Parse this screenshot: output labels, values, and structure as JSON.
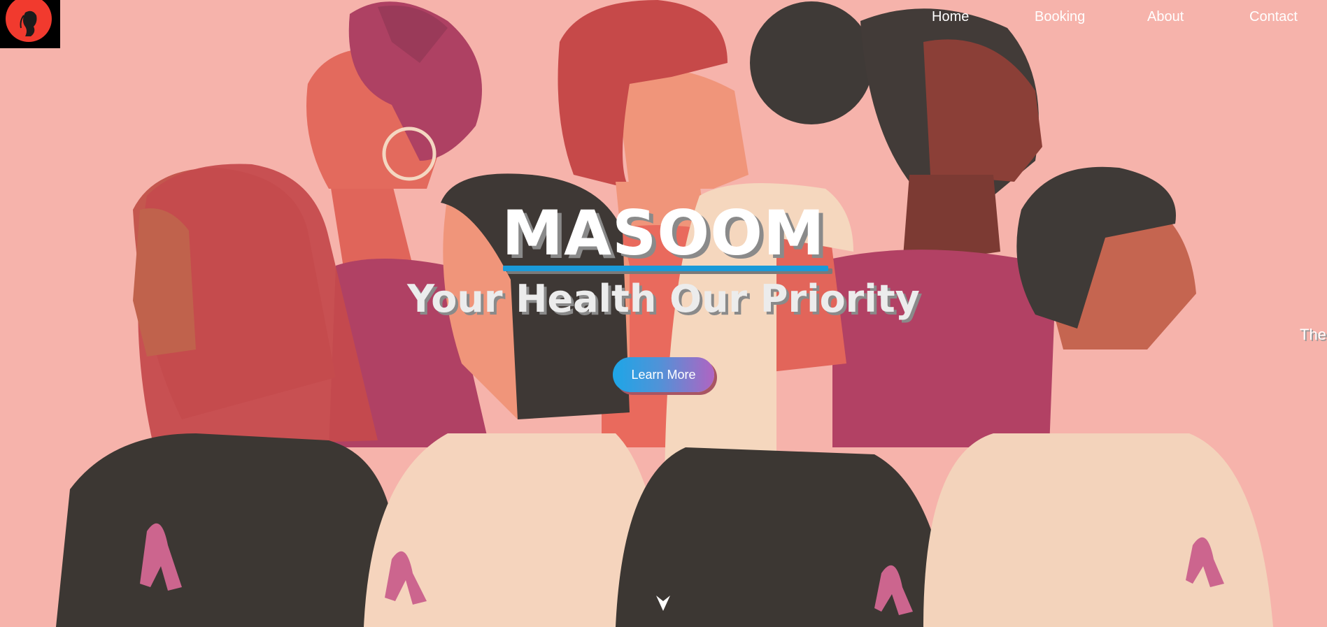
{
  "logo": {
    "text": "MASOOM",
    "alt_icon": "woman-silhouette-icon"
  },
  "nav": {
    "items": [
      {
        "label": "Home",
        "active": true
      },
      {
        "label": "Booking",
        "active": false
      },
      {
        "label": "About",
        "active": false
      },
      {
        "label": "Contact",
        "active": false
      }
    ]
  },
  "hero": {
    "title": "MASOOM",
    "tagline": "Your Health Our Priority",
    "cta_label": "Learn More",
    "side_text": "The",
    "scroll_icon": "arrow-down-icon",
    "illustration": "women-with-pink-ribbons"
  },
  "colors": {
    "background": "#f6b3ab",
    "accent_blue": "#1a9ad9",
    "cta_start": "#1da6e7",
    "cta_end": "#b064c2"
  }
}
